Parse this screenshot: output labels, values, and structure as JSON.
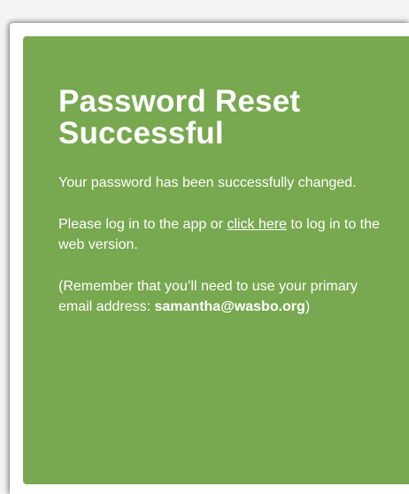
{
  "card": {
    "title_line1": "Password Reset",
    "title_line2": "Successful",
    "message_changed": "Your password has been successfully changed.",
    "login_prefix": "Please log in to the app or ",
    "login_link": "click here",
    "login_suffix": " to log in to the web version.",
    "reminder_prefix": "(Remember that you’ll need to use your primary email address: ",
    "reminder_email": "samantha@wasbo.org",
    "reminder_suffix": ")"
  },
  "colors": {
    "card_background": "#78a84f",
    "text": "#ffffff",
    "page_background": "#ffffff"
  }
}
